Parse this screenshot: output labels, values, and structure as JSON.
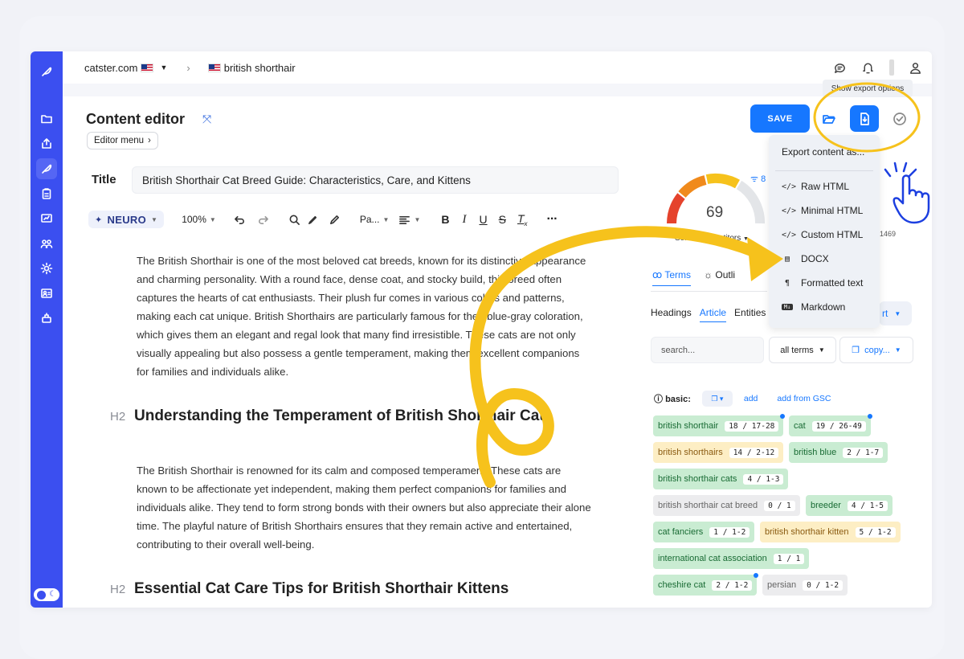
{
  "topbar": {
    "site": "catster.com",
    "breadcrumb": "british shorthair"
  },
  "editor": {
    "heading": "Content editor",
    "menu_label": "Editor menu",
    "title_label": "Title",
    "title_value": "British Shorthair Cat Breed Guide: Characteristics, Care, and Kittens",
    "toolbar": {
      "neuro": "NEURO",
      "zoom": "100%",
      "paragraph": "Pa..."
    },
    "paragraphs": [
      "The British Shorthair is one of the most beloved cat breeds, known for its distinctive appearance and charming personality. With a round face, dense coat, and stocky build, this breed often captures the hearts of cat enthusiasts. Their plush fur comes in various colors and patterns, making each cat unique. British Shorthairs are particularly famous for their blue-gray coloration, which gives them an elegant and regal look that many find irresistible. These cats are not only visually appealing but also possess a gentle temperament, making them excellent companions for families and individuals alike.",
      "The British Shorthair is renowned for its calm and composed temperament. These cats are known to be affectionate yet independent, making them perfect companions for families and individuals alike. They tend to form strong bonds with their owners but also appreciate their alone time. The playful nature of British Shorthairs ensures that they remain active and entertained, contributing to their overall well-being."
    ],
    "h2_tag": "H2",
    "headings": [
      "Understanding the Temperament of British Shorthair Cats",
      "Essential Cat Care Tips for British Shorthair Kittens"
    ]
  },
  "actions": {
    "save_label": "SAVE",
    "tooltip": "Show export options"
  },
  "export_menu": {
    "title": "Export content as...",
    "items": [
      {
        "icon": "</>",
        "label": "Raw HTML"
      },
      {
        "icon": "</>",
        "label": "Minimal HTML"
      },
      {
        "icon": "</>",
        "label": "Custom HTML"
      },
      {
        "icon": "doc",
        "label": "DOCX"
      },
      {
        "icon": "¶",
        "label": "Formatted text"
      },
      {
        "icon": "md",
        "label": "Markdown"
      }
    ]
  },
  "score": {
    "value": "69",
    "select_label": "Select competitors",
    "metric_a": "8",
    "metric_b": "1469"
  },
  "panel": {
    "tab_terms": "Terms",
    "tab_outline": "Outli",
    "sub_headings": "Headings",
    "sub_article": "Article",
    "sub_entities": "Entities",
    "sub_right": "rt",
    "search_placeholder": "search...",
    "filter": "all terms",
    "copy": "copy...",
    "basic_label": "basic:",
    "add": "add",
    "add_gsc": "add from GSC"
  },
  "terms": [
    {
      "name": "british shorthair",
      "count": "18 / 17-28",
      "style": "green",
      "dot": true
    },
    {
      "name": "cat",
      "count": "19 / 26-49",
      "style": "green",
      "dot": true
    },
    {
      "name": "british shorthairs",
      "count": "14 / 2-12",
      "style": "orange",
      "dot": false
    },
    {
      "name": "british blue",
      "count": "2 / 1-7",
      "style": "green",
      "dot": false
    },
    {
      "name": "british shorthair cats",
      "count": "4 / 1-3",
      "style": "green",
      "dot": false
    },
    {
      "name": "british shorthair cat breed",
      "count": "0 / 1",
      "style": "gray",
      "dot": false
    },
    {
      "name": "breeder",
      "count": "4 / 1-5",
      "style": "green",
      "dot": false
    },
    {
      "name": "cat fanciers",
      "count": "1 / 1-2",
      "style": "green",
      "dot": false
    },
    {
      "name": "british shorthair kitten",
      "count": "5 / 1-2",
      "style": "orange",
      "dot": false
    },
    {
      "name": "international cat association",
      "count": "1 / 1",
      "style": "green",
      "dot": false
    },
    {
      "name": "cheshire cat",
      "count": "2 / 1-2",
      "style": "green",
      "dot": true
    },
    {
      "name": "persian",
      "count": "0 / 1-2",
      "style": "gray",
      "dot": false
    }
  ],
  "colors": {
    "sidebar": "#3b4ff0",
    "accent": "#1677ff",
    "annotation": "#f6c21c"
  }
}
